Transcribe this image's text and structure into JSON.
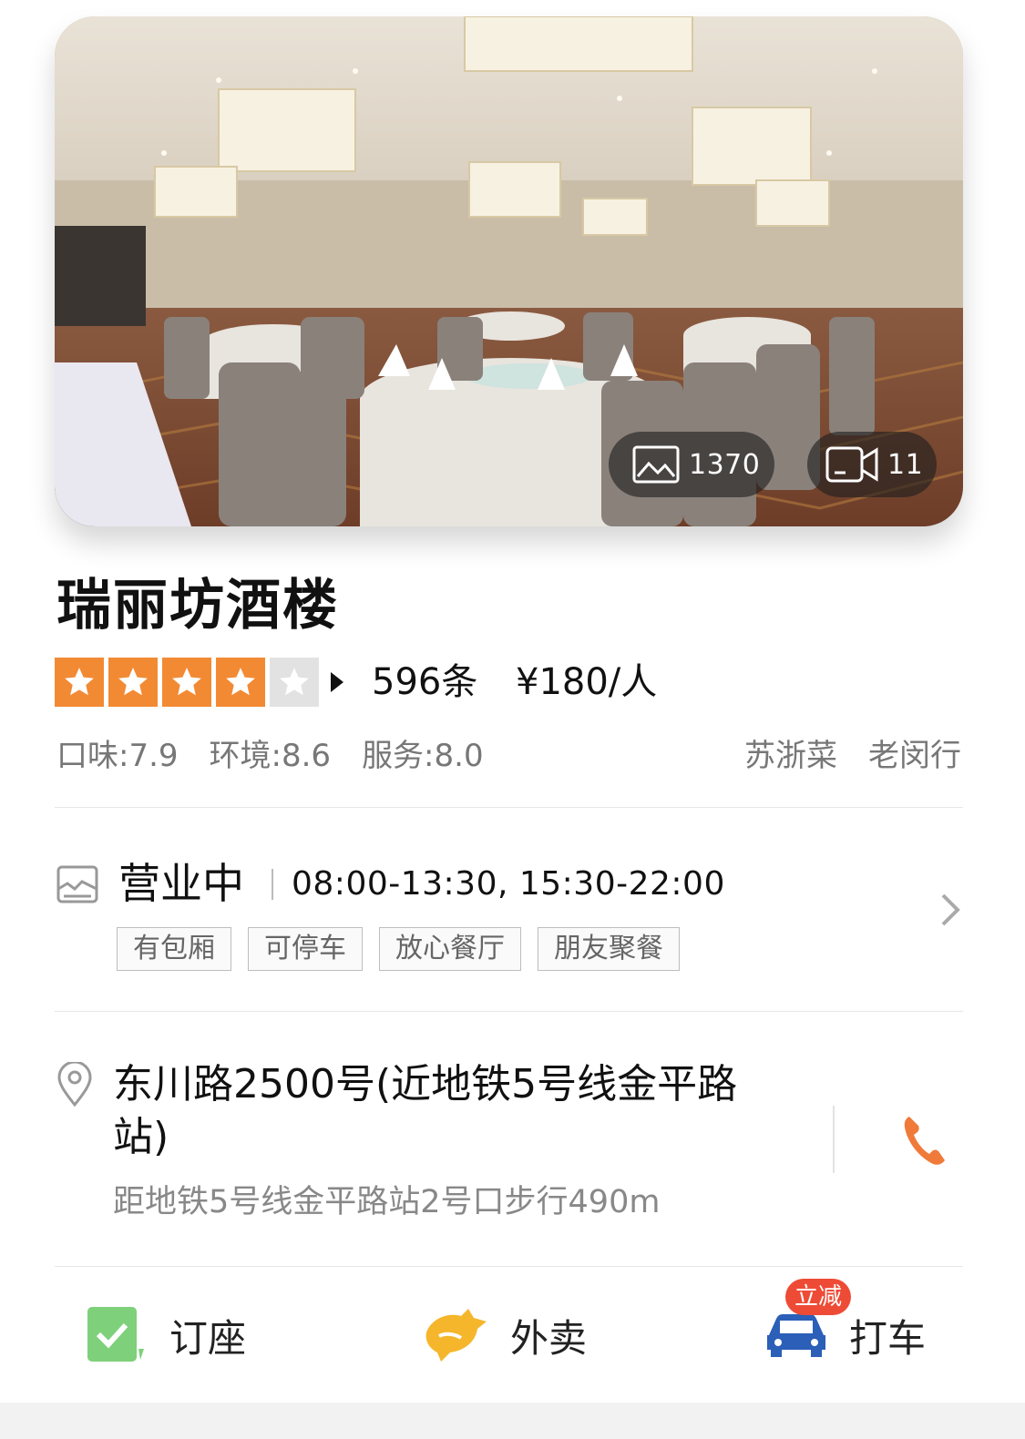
{
  "hero": {
    "photo_count": "1370",
    "video_count": "11",
    "photo_icon": "image-icon",
    "video_icon": "video-camera-icon"
  },
  "restaurant": {
    "name": "瑞丽坊酒楼",
    "rating_stars": 4,
    "rating_max": 5,
    "review_count": "596条",
    "price_per_person": "¥180/人",
    "scores": {
      "taste": "口味:7.9",
      "environment": "环境:8.6",
      "service": "服务:8.0"
    },
    "cuisine": "苏浙菜",
    "district": "老闵行"
  },
  "hours": {
    "status": "营业中",
    "times": "08:00-13:30, 15:30-22:00",
    "features": [
      "有包厢",
      "可停车",
      "放心餐厅",
      "朋友聚餐"
    ]
  },
  "location": {
    "address": "东川路2500号(近地铁5号线金平路站)",
    "distance": "距地铁5号线金平路站2号口步行490m"
  },
  "actions": {
    "book": "订座",
    "takeout": "外卖",
    "taxi": "打车",
    "taxi_badge": "立减"
  },
  "colors": {
    "star_on": "#f28a34",
    "star_off": "#e2e2e2",
    "phone": "#f07a3a",
    "book_green": "#7ed07a",
    "takeout_yellow": "#f5b62b",
    "taxi_blue": "#2b5fb8",
    "badge_red": "#ee4b36"
  }
}
